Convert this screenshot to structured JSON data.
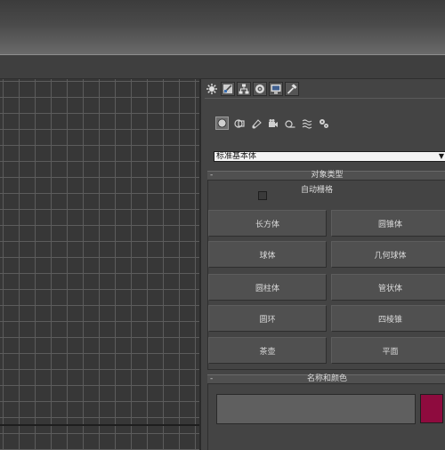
{
  "command_panel": {
    "tabs": [
      {
        "name": "create",
        "active": true
      },
      {
        "name": "modify",
        "active": false
      },
      {
        "name": "hierarchy",
        "active": false
      },
      {
        "name": "motion",
        "active": false
      },
      {
        "name": "display",
        "active": false
      },
      {
        "name": "utilities",
        "active": false
      }
    ],
    "categories": [
      {
        "name": "geometry",
        "active": true
      },
      {
        "name": "shapes",
        "active": false
      },
      {
        "name": "lights",
        "active": false
      },
      {
        "name": "cameras",
        "active": false
      },
      {
        "name": "helpers",
        "active": false
      },
      {
        "name": "space-warps",
        "active": false
      },
      {
        "name": "systems",
        "active": false
      }
    ],
    "primitive_type": "标准基本体",
    "object_type": {
      "title": "对象类型",
      "collapse_symbol": "-",
      "autogrid_label": "自动栅格",
      "autogrid_checked": false,
      "buttons": [
        "长方体",
        "圆锥体",
        "球体",
        "几何球体",
        "圆柱体",
        "管状体",
        "圆环",
        "四棱锥",
        "茶壶",
        "平面"
      ]
    },
    "name_color": {
      "title": "名称和颜色",
      "collapse_symbol": "-",
      "name_value": "",
      "color": "#8e0b3e"
    }
  },
  "colors": {
    "background": "#444444",
    "viewport_bg": "#373737",
    "grid_line": "#5c5c5c",
    "object_color": "#8e0b3e"
  }
}
